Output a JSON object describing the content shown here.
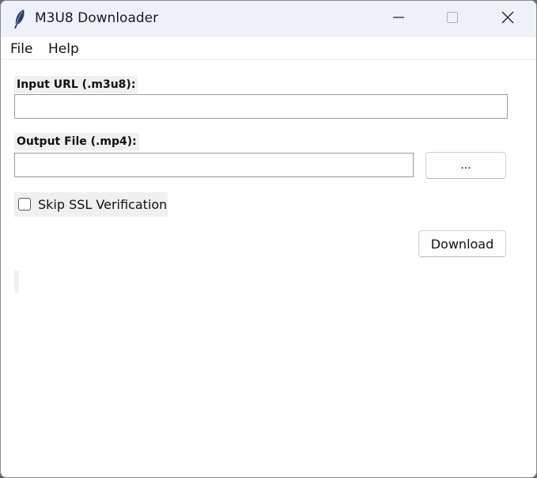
{
  "window": {
    "title": "M3U8 Downloader",
    "icon": "feather-icon",
    "controls": {
      "minimize_icon": "minimize-icon",
      "maximize_icon": "maximize-icon",
      "close_icon": "close-icon"
    }
  },
  "menubar": {
    "items": [
      {
        "label": "File"
      },
      {
        "label": "Help"
      }
    ]
  },
  "form": {
    "input_url": {
      "label": "Input URL (.m3u8):",
      "value": ""
    },
    "output_file": {
      "label": "Output File (.mp4):",
      "value": ""
    },
    "browse_button": "...",
    "skip_ssl": {
      "label": "Skip SSL Verification",
      "checked": false
    },
    "download_button": "Download"
  },
  "status": {
    "text": ""
  },
  "colors": {
    "titlebar_bg": "#eef2f8",
    "label_bg": "#f0f0f0",
    "window_bg": "#ffffff"
  }
}
